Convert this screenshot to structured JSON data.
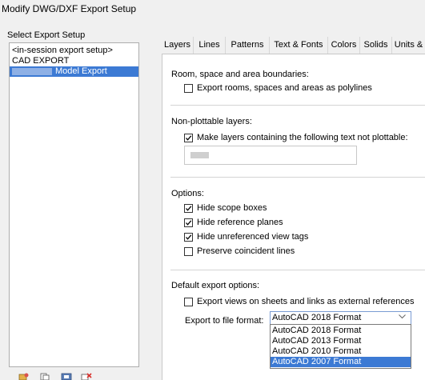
{
  "window": {
    "title": "Modify DWG/DXF Export Setup"
  },
  "setup_list": {
    "label": "Select Export Setup",
    "items": [
      {
        "label": "<in-session export setup>",
        "selected": false
      },
      {
        "label": "CAD EXPORT",
        "selected": false
      },
      {
        "label": "Model Export",
        "selected": true
      }
    ]
  },
  "tabs": [
    {
      "label": "Layers",
      "active": true
    },
    {
      "label": "Lines",
      "active": false
    },
    {
      "label": "Patterns",
      "active": false
    },
    {
      "label": "Text & Fonts",
      "active": false
    },
    {
      "label": "Colors",
      "active": false
    },
    {
      "label": "Solids",
      "active": false
    },
    {
      "label": "Units &",
      "active": false
    }
  ],
  "room_section": {
    "label": "Room, space and area boundaries:",
    "export_rooms": {
      "label": "Export rooms, spaces and areas as polylines",
      "checked": false
    }
  },
  "nonplot_section": {
    "label": "Non-plottable layers:",
    "make_layers": {
      "label": "Make layers containing the following text not plottable:",
      "checked": true
    }
  },
  "options_section": {
    "label": "Options:",
    "hide_scope": {
      "label": "Hide scope boxes",
      "checked": true
    },
    "hide_ref_planes": {
      "label": "Hide reference planes",
      "checked": true
    },
    "hide_view_tags": {
      "label": "Hide unreferenced view tags",
      "checked": true
    },
    "preserve_lines": {
      "label": "Preserve coincident lines",
      "checked": false
    }
  },
  "default_section": {
    "label": "Default export options:",
    "export_views": {
      "label": "Export views on sheets and links as external references",
      "checked": false
    },
    "format_label": "Export to file format:",
    "format_selected": "AutoCAD 2018 Format",
    "format_options": [
      {
        "label": "AutoCAD 2018 Format",
        "highlighted": false
      },
      {
        "label": "AutoCAD 2013 Format",
        "highlighted": false
      },
      {
        "label": "AutoCAD 2010 Format",
        "highlighted": false
      },
      {
        "label": "AutoCAD 2007 Format",
        "highlighted": true
      }
    ]
  },
  "toolbar": {
    "icons": [
      "new-setup-icon",
      "duplicate-setup-icon",
      "rename-setup-icon",
      "delete-setup-icon"
    ]
  },
  "colors": {
    "selection": "#3c7ad4",
    "background": "#f0f0f0"
  }
}
